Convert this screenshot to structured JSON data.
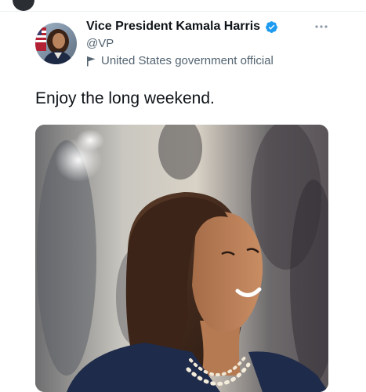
{
  "tweet": {
    "author": {
      "display_name": "Vice President Kamala Harris",
      "handle": "@VP",
      "affiliation": "United States government official",
      "verified": true
    },
    "text": "Enjoy the long weekend.",
    "media": {
      "type": "photo"
    }
  },
  "icons": {
    "verified": "verified-badge-icon",
    "affiliation": "government-flag-icon",
    "more": "more-options-icon"
  },
  "colors": {
    "verified_blue": "#1d9bf0",
    "secondary_text": "#536471",
    "primary_text": "#0f1419"
  }
}
